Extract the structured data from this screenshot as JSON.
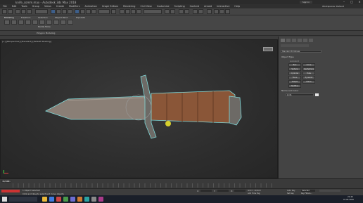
{
  "window": {
    "title": "knife_comm.max - Autodesk 3ds Max 2018"
  },
  "menu": [
    "File",
    "Edit",
    "Tools",
    "Group",
    "Views",
    "Create",
    "Modifiers",
    "Animation",
    "Graph Editors",
    "Rendering",
    "Civil View",
    "Customize",
    "Scripting",
    "Content",
    "Arnold",
    "Interactive",
    "Help"
  ],
  "signin": "Sign In",
  "workspace": "Workspaces: Default",
  "ribbon": {
    "tabs": [
      "Modeling",
      "Freeform",
      "Selection",
      "Object Paint",
      "Populate"
    ],
    "group_label": "Polygon Modeling",
    "modify_mode": "Modify Mode"
  },
  "viewport": {
    "label": "[+] [Perspective] [Standard] [Default Shading]"
  },
  "command_panel": {
    "dropdown": "Standard Primitives",
    "rollout_object_type": "Object Type",
    "autogrid": "AutoGrid",
    "buttons": [
      "Box",
      "Cone",
      "Sphere",
      "GeoSphere",
      "Cylinder",
      "Tube",
      "Torus",
      "Pyramid",
      "Teapot",
      "Plane",
      "TextPlus"
    ],
    "rollout_name_color": "Name and Color",
    "name_value": "knife"
  },
  "timeline": {
    "frame": "0 / 100"
  },
  "status": {
    "selection": "1 Object Selected",
    "prompt": "Click and drag to select and move objects",
    "x_label": "X:",
    "y_label": "Y:",
    "z_label": "Z:",
    "grid": "Grid = 10,0cm",
    "addtime": "Add Time Tag",
    "autokey": "Auto Key",
    "selected": "Selected",
    "setkey": "Set Key",
    "keyfilters": "Key Filters..."
  },
  "taskbar": {
    "time": "21:22",
    "date": "07.05.2020"
  }
}
